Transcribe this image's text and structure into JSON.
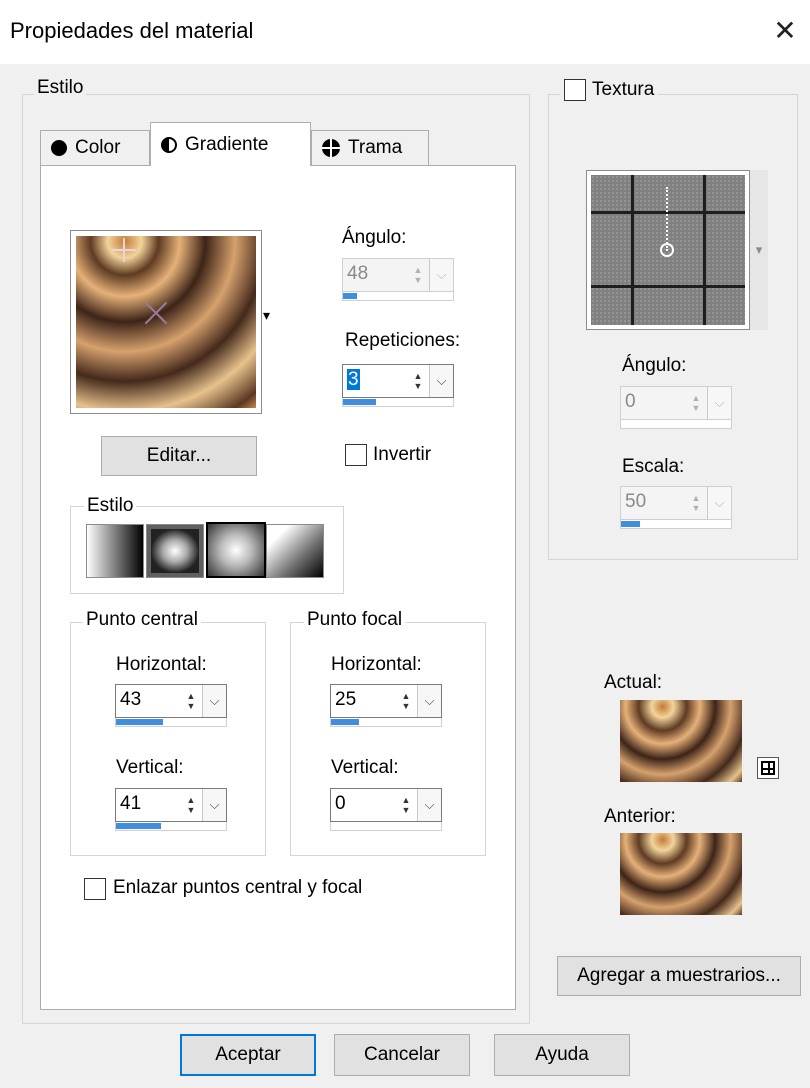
{
  "window": {
    "title": "Propiedades del material",
    "close_glyph": "✕"
  },
  "estilo_group": {
    "legend": "Estilo"
  },
  "tabs": [
    {
      "label": "Color",
      "icon": "circle-icon"
    },
    {
      "label": "Gradiente",
      "icon": "half-circle-icon",
      "selected": true
    },
    {
      "label": "Trama",
      "icon": "pattern-icon"
    }
  ],
  "gradient": {
    "dropdown_glyph": "▾",
    "edit_label": "Editar...",
    "angle": {
      "label": "Ángulo:",
      "value": "48",
      "fill": 0.13
    },
    "repetitions": {
      "label": "Repeticiones:",
      "value": "3",
      "fill": 0.3
    },
    "invert_label": "Invertir",
    "style_group": {
      "legend": "Estilo",
      "tiles": [
        "linear",
        "rectangular",
        "sunburst",
        "radial"
      ],
      "selected_index": 2
    },
    "center_point": {
      "legend": "Punto central",
      "horizontal": {
        "label": "Horizontal:",
        "value": "43",
        "fill": 0.43
      },
      "vertical": {
        "label": "Vertical:",
        "value": "41",
        "fill": 0.41
      }
    },
    "focal_point": {
      "legend": "Punto focal",
      "horizontal": {
        "label": "Horizontal:",
        "value": "25",
        "fill": 0.25
      },
      "vertical": {
        "label": "Vertical:",
        "value": "0",
        "fill": 0
      }
    },
    "link_label": "Enlazar puntos central y focal"
  },
  "texture": {
    "checkbox_label": "Textura",
    "dropdown_glyph": "▾",
    "angle": {
      "label": "Ángulo:",
      "value": "0",
      "fill": 0
    },
    "scale": {
      "label": "Escala:",
      "value": "50",
      "fill": 0.17
    }
  },
  "preview": {
    "current_label": "Actual:",
    "previous_label": "Anterior:"
  },
  "swatches_button": "Agregar a muestrarios...",
  "buttons": {
    "ok": "Aceptar",
    "cancel": "Cancelar",
    "help": "Ayuda"
  },
  "spin_glyphs": {
    "up": "▲",
    "down": "▼",
    "drop": "⌵"
  },
  "colors": {
    "accent": "#0078d7",
    "bar": "#3f8fde",
    "bg": "#f0f0f0"
  }
}
